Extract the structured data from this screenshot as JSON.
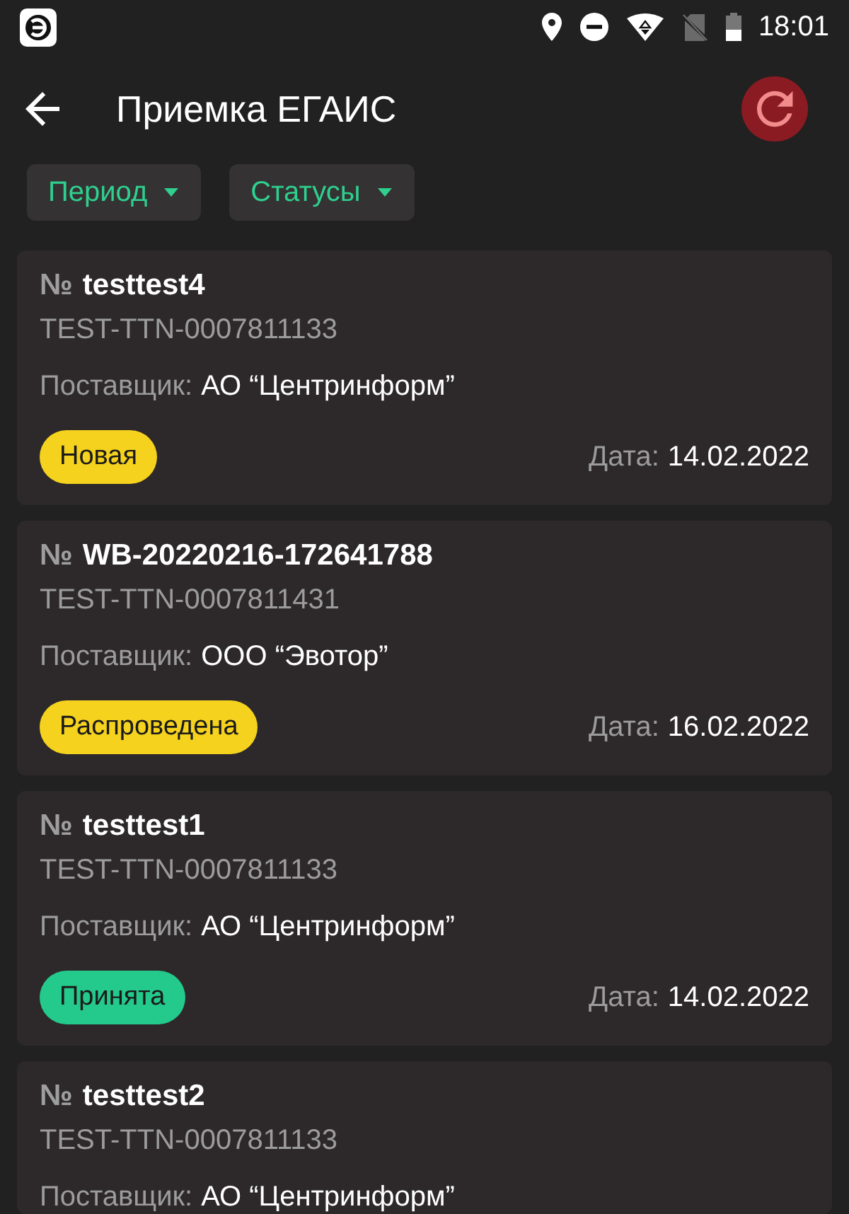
{
  "status_bar": {
    "time": "18:01"
  },
  "toolbar": {
    "title": "Приемка ЕГАИС"
  },
  "filters": [
    {
      "label": "Период"
    },
    {
      "label": "Статусы"
    }
  ],
  "documents": [
    {
      "number_label": "№",
      "number": "testtest4",
      "ttn": "TEST-TTN-0007811133",
      "supplier_label": "Поставщик:",
      "supplier": "АО “Центринформ”",
      "status": {
        "label": "Новая",
        "color": "#f5d21e"
      },
      "date_label": "Дата:",
      "date": "14.02.2022"
    },
    {
      "number_label": "№",
      "number": "WB-20220216-172641788",
      "ttn": "TEST-TTN-0007811431",
      "supplier_label": "Поставщик:",
      "supplier": "ООО “Эвотор”",
      "status": {
        "label": "Распроведена",
        "color": "#f5d21e"
      },
      "date_label": "Дата:",
      "date": "16.02.2022"
    },
    {
      "number_label": "№",
      "number": "testtest1",
      "ttn": "TEST-TTN-0007811133",
      "supplier_label": "Поставщик:",
      "supplier": "АО “Центринформ”",
      "status": {
        "label": "Принята",
        "color": "#24c98c"
      },
      "date_label": "Дата:",
      "date": "14.02.2022"
    },
    {
      "number_label": "№",
      "number": "testtest2",
      "ttn": "TEST-TTN-0007811133",
      "supplier_label": "Поставщик:",
      "supplier": "АО “Центринформ”"
    }
  ]
}
